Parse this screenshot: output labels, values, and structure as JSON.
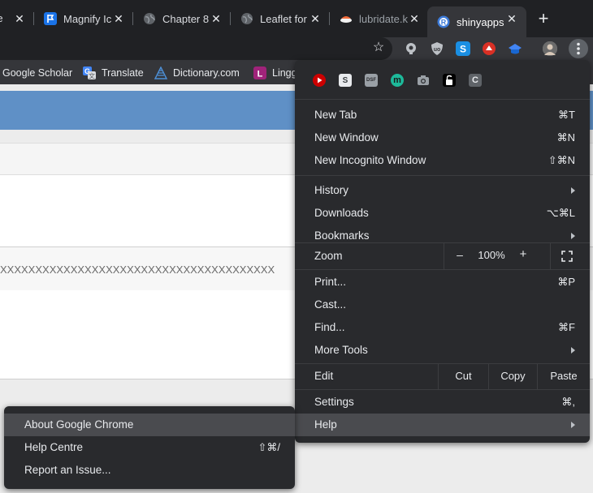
{
  "tabs": [
    {
      "title": "re",
      "icon": "globe-icon"
    },
    {
      "title": "Magnify Ic",
      "icon": "flag-icon"
    },
    {
      "title": "Chapter 8",
      "icon": "globe-icon"
    },
    {
      "title": "Leaflet for",
      "icon": "globe-icon"
    },
    {
      "title": "lubridate.k",
      "icon": "sushi-icon"
    },
    {
      "title": "shinyapps",
      "icon": "shinyapps-icon"
    }
  ],
  "bookmarks": [
    {
      "label": "Google Scholar",
      "icon": "google-scholar-icon"
    },
    {
      "label": "Translate",
      "icon": "google-translate-icon"
    },
    {
      "label": "Dictionary.com",
      "icon": "dictionary-icon"
    },
    {
      "label": "Lingg",
      "icon": "lingg-icon"
    }
  ],
  "page": {
    "row_text": "XXXXXXXXXXXXXXXXXXXXXXXXXXXXXXXXXXXXXXX"
  },
  "menu": {
    "extension_icons": [
      "youtube-icon",
      "s-icon",
      "dsf-icon",
      "m-icon",
      "camera-icon",
      "lock-icon",
      "c-icon"
    ],
    "extension_letters": {
      "s": "S",
      "dsf": "DSF",
      "m": "m",
      "c": "C"
    },
    "new_tab": {
      "label": "New Tab",
      "shortcut": "⌘T"
    },
    "new_window": {
      "label": "New Window",
      "shortcut": "⌘N"
    },
    "new_incognito": {
      "label": "New Incognito Window",
      "shortcut": "⇧⌘N"
    },
    "history": {
      "label": "History"
    },
    "downloads": {
      "label": "Downloads",
      "shortcut": "⌥⌘L"
    },
    "bookmarks": {
      "label": "Bookmarks"
    },
    "zoom": {
      "label": "Zoom",
      "minus": "–",
      "value": "100%",
      "plus": "+"
    },
    "print": {
      "label": "Print...",
      "shortcut": "⌘P"
    },
    "cast": {
      "label": "Cast..."
    },
    "find": {
      "label": "Find...",
      "shortcut": "⌘F"
    },
    "more_tools": {
      "label": "More Tools"
    },
    "edit": {
      "label": "Edit",
      "cut": "Cut",
      "copy": "Copy",
      "paste": "Paste"
    },
    "settings": {
      "label": "Settings",
      "shortcut": "⌘,"
    },
    "help": {
      "label": "Help"
    }
  },
  "help_submenu": {
    "about": {
      "label": "About Google Chrome"
    },
    "help_centre": {
      "label": "Help Centre",
      "shortcut": "⇧⌘/"
    },
    "report": {
      "label": "Report an Issue..."
    }
  },
  "colors": {
    "tab_strip": "#202124",
    "toolbar": "#35363a",
    "menu_bg": "#292a2d",
    "menu_highlight": "#4a4b4f",
    "banner": "#5f90c6"
  }
}
